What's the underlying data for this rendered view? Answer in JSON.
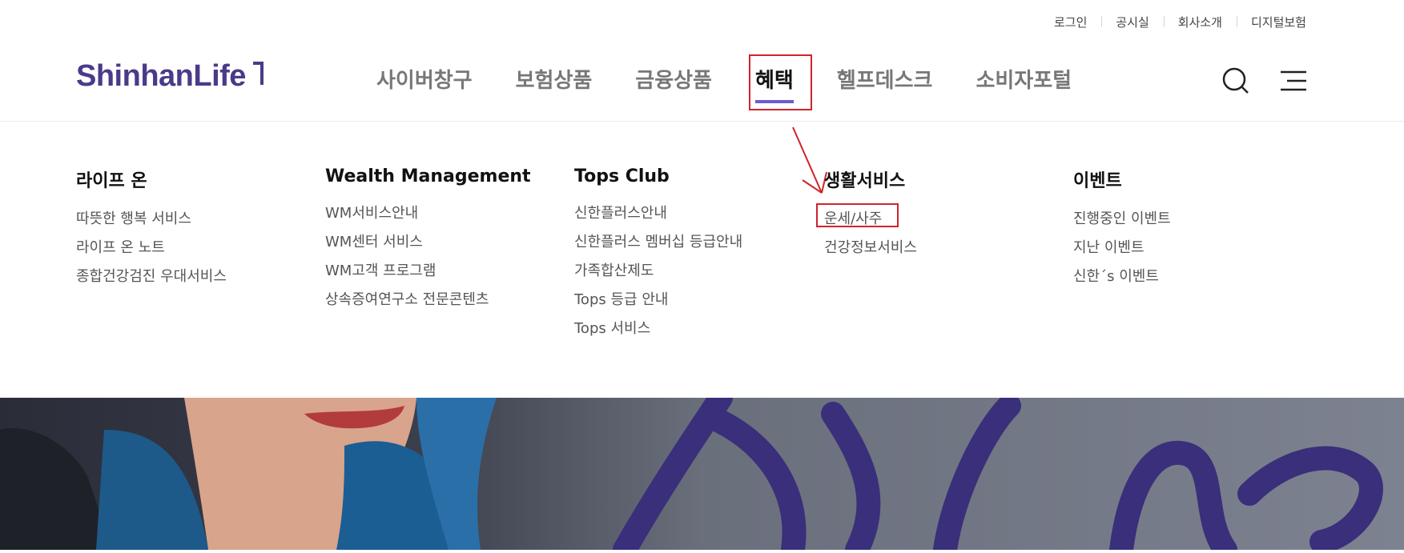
{
  "utility_nav": [
    "로그인",
    "공시실",
    "회사소개",
    "디지털보험"
  ],
  "logo": {
    "text": "ShinhanLife"
  },
  "gnb": [
    {
      "label": "사이버창구"
    },
    {
      "label": "보험상품"
    },
    {
      "label": "금융상품"
    },
    {
      "label": "혜택",
      "active": true
    },
    {
      "label": "헬프데스크"
    },
    {
      "label": "소비자포털"
    }
  ],
  "header_icons": [
    "search-icon",
    "menu-icon"
  ],
  "mega_menu": [
    {
      "title": "라이프 온",
      "items": [
        "따뜻한 행복 서비스",
        "라이프 온 노트",
        "종합건강검진 우대서비스"
      ]
    },
    {
      "title": "Wealth Management",
      "items": [
        "WM서비스안내",
        "WM센터 서비스",
        "WM고객 프로그램",
        "상속증여연구소 전문콘텐츠"
      ]
    },
    {
      "title": "Tops Club",
      "items": [
        "신한플러스안내",
        "신한플러스 멤버십 등급안내",
        "가족합산제도",
        "Tops 등급 안내",
        "Tops 서비스"
      ]
    },
    {
      "title": "생활서비스",
      "items": [
        "운세/사주",
        "건강정보서비스"
      ]
    },
    {
      "title": "이벤트",
      "items": [
        "진행중인 이벤트",
        "지난 이벤트",
        "신한´s 이벤트"
      ]
    }
  ],
  "colors": {
    "brand": "#4b3a8a",
    "active_underline": "#6d5bd0",
    "highlight": "#d0232a"
  }
}
